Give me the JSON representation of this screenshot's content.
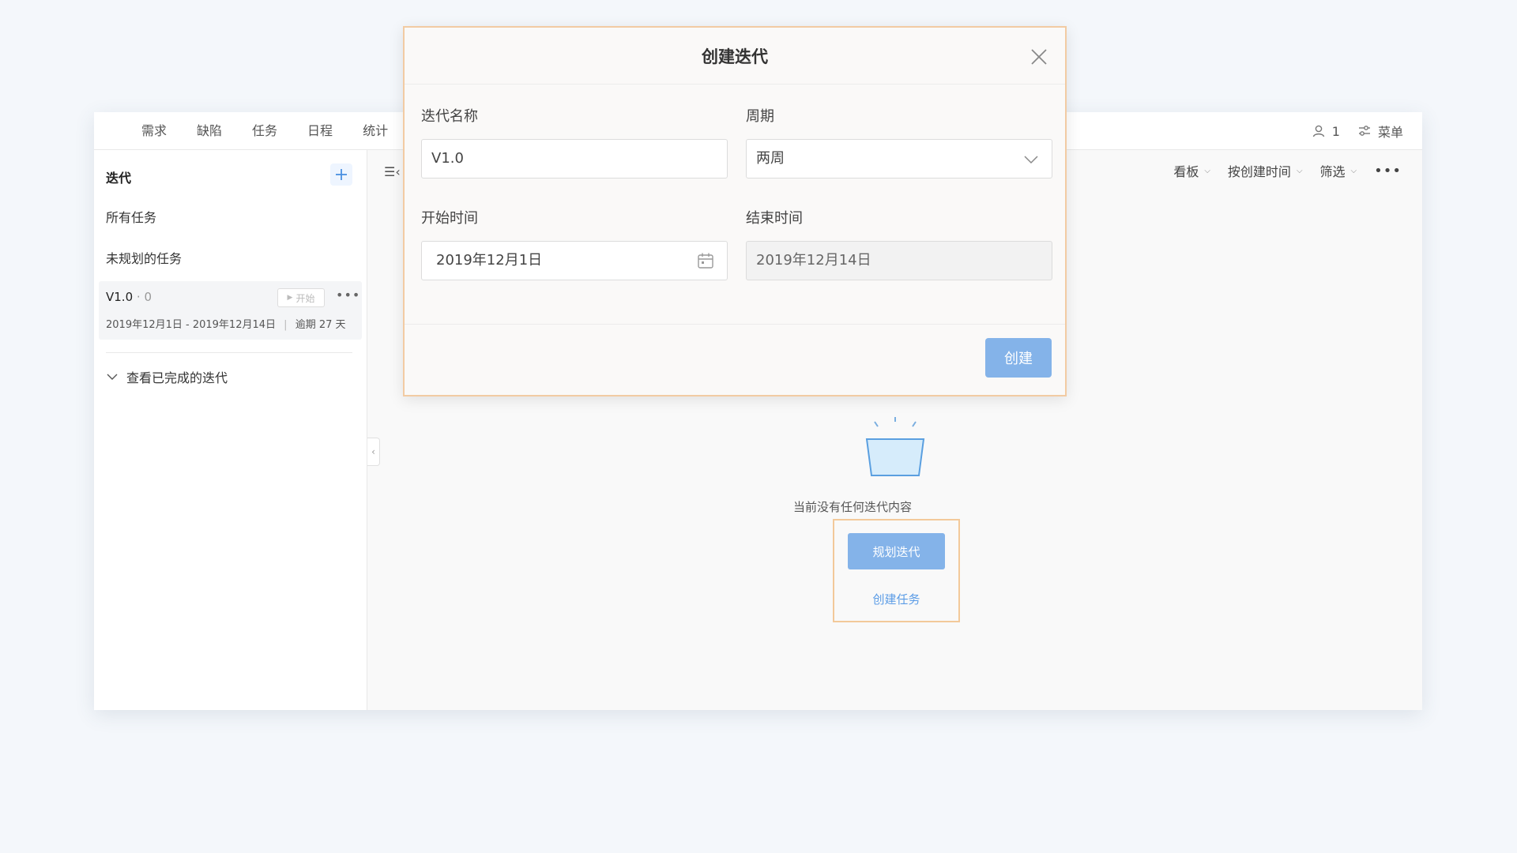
{
  "topnav": {
    "tabs": [
      "需求",
      "缺陷",
      "任务",
      "日程",
      "统计"
    ],
    "member_count": "1",
    "menu_label": "菜单"
  },
  "sidebar": {
    "header": "迭代",
    "items": [
      "所有任务",
      "未规划的任务"
    ],
    "iteration": {
      "name": "V1.0",
      "count": "0",
      "start_label": "开始",
      "dates": "2019年12月1日 - 2019年12月14日",
      "overdue": "逾期 27 天"
    },
    "completed_label": "查看已完成的迭代"
  },
  "toolbar": {
    "left_icon": "☰‹",
    "view": "看板",
    "sort": "按创建时间",
    "filter": "筛选"
  },
  "empty_state": {
    "message": "当前没有任何迭代内容",
    "plan_button": "规划迭代",
    "create_task_link": "创建任务"
  },
  "modal": {
    "title": "创建迭代",
    "name_label": "迭代名称",
    "name_value": "V1.0",
    "period_label": "周期",
    "period_value": "两周",
    "start_label": "开始时间",
    "start_value": "2019年12月1日",
    "end_label": "结束时间",
    "end_value": "2019年12月14日",
    "create_button": "创建"
  },
  "colors": {
    "accent": "#84b3e9",
    "link": "#5b9ce6",
    "highlight_border": "#f3c99a"
  }
}
